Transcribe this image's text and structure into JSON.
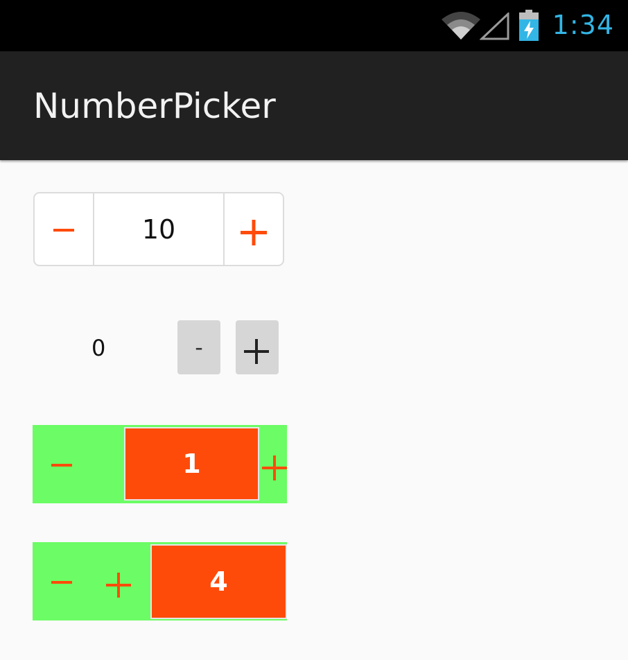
{
  "status_bar": {
    "time": "1:34",
    "icons": [
      "wifi-icon",
      "cell-signal-icon",
      "battery-charging-icon"
    ],
    "accent_color": "#33b5e5"
  },
  "action_bar": {
    "title": "NumberPicker"
  },
  "pickers": [
    {
      "style": "bordered-white",
      "value": "10",
      "decrement_icon": "minus-icon",
      "increment_icon": "plus-icon",
      "icon_color": "#ff4b0a"
    },
    {
      "style": "gray-buttons",
      "value": "0",
      "decrement_label": "-",
      "increment_icon": "plus-icon"
    },
    {
      "style": "green-orange",
      "value": "1",
      "decrement_icon": "minus-icon",
      "increment_icon": "plus-icon",
      "button_bg": "#6cfc65",
      "value_bg": "#ff4b0a"
    },
    {
      "style": "green-orange-buttons-left",
      "value": "4",
      "decrement_icon": "minus-icon",
      "increment_icon": "plus-icon",
      "button_bg": "#6cfc65",
      "value_bg": "#ff4b0a"
    }
  ]
}
